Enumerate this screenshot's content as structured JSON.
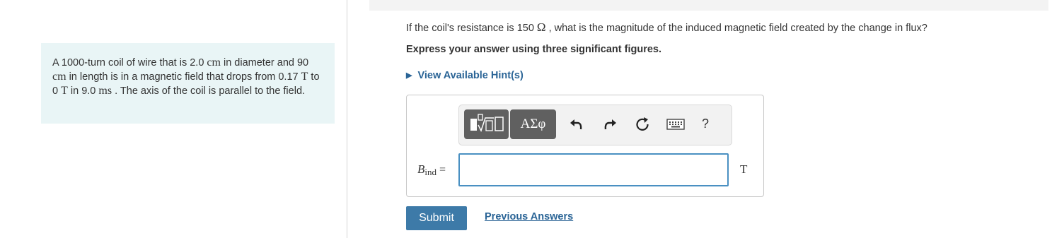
{
  "problem": {
    "t1": "A 1000-turn coil of wire that is 2.0 ",
    "u1": "cm",
    "t2": " in diameter and 90 ",
    "u2": "cm",
    "t3": " in length is in a magnetic field that drops from 0.17 ",
    "u3": "T",
    "t4": " to 0 ",
    "u4": "T",
    "t5": " in 9.0 ",
    "u5": "ms",
    "t6": " . The axis of the coil is parallel to the field."
  },
  "question": {
    "t1": "If the coil's resistance is 150 ",
    "unit": "Ω",
    "t2": " , what is the magnitude of the induced magnetic field created by the change in flux?"
  },
  "instruction": "Express your answer using three significant figures.",
  "hints": {
    "arrow": "▶",
    "label": "View Available Hint(s)"
  },
  "toolbar": {
    "greek_label": "ΑΣφ",
    "icons": [
      "templates-icon",
      "greek-letters-icon",
      "undo-icon",
      "redo-icon",
      "reset-icon",
      "keyboard-icon",
      "help-icon"
    ],
    "help_label": "?"
  },
  "answer": {
    "var_main": "B",
    "var_sub": "ind",
    "equals": " =",
    "value": "",
    "unit": "T"
  },
  "actions": {
    "submit_label": "Submit",
    "previous_label": "Previous Answers"
  }
}
